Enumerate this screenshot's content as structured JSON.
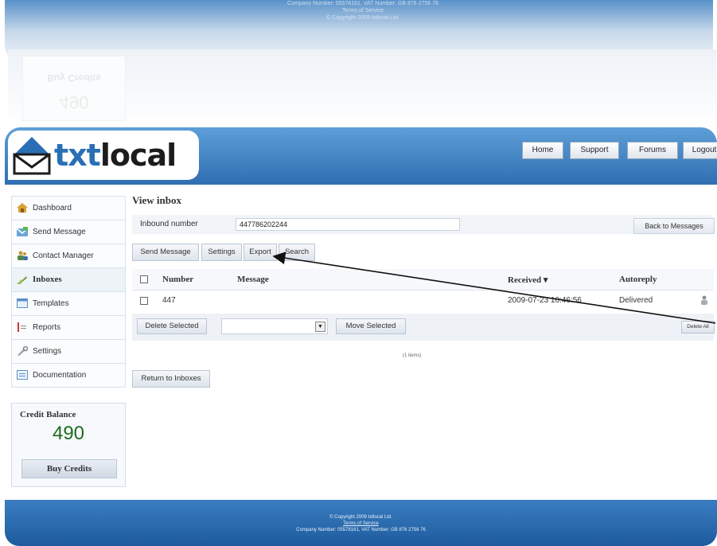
{
  "reflection": {
    "lines": [
      "Company Number: 05578161, VAT Number: GB 876 2756 76",
      "Terms of Service",
      "© Copyright 2009 txtlocal Ltd."
    ],
    "card_title": "Buy Credits",
    "card_value": "490"
  },
  "brand": {
    "logo_text_a": "txt",
    "logo_text_b": "local"
  },
  "nav": {
    "home": "Home",
    "support": "Support",
    "forums": "Forums",
    "logout": "Logout"
  },
  "sidebar": {
    "items": [
      {
        "label": "Dashboard",
        "icon": "house-icon"
      },
      {
        "label": "Send Message",
        "icon": "envelope-icon"
      },
      {
        "label": "Contact Manager",
        "icon": "people-icon"
      },
      {
        "label": "Inboxes",
        "icon": "inbox-icon"
      },
      {
        "label": "Templates",
        "icon": "template-icon"
      },
      {
        "label": "Reports",
        "icon": "report-icon"
      },
      {
        "label": "Settings",
        "icon": "wrench-icon"
      },
      {
        "label": "Documentation",
        "icon": "document-icon"
      }
    ]
  },
  "credit": {
    "title": "Credit Balance",
    "value": "490",
    "buy_label": "Buy Credits"
  },
  "main": {
    "title": "View inbox",
    "inbound_label": "Inbound number",
    "inbound_value": "447786202244",
    "back_label": "Back to Messages",
    "toolbar": {
      "send": "Send Message",
      "settings": "Settings",
      "export": "Export",
      "search": "Search"
    },
    "columns": {
      "number": "Number",
      "message": "Message",
      "received": "Received ▾",
      "autoreply": "Autoreply"
    },
    "rows": [
      {
        "number": "447",
        "message": "",
        "received": "2009-07-23 10:46:56",
        "autoreply": "Delivered"
      }
    ],
    "delete_selected": "Delete Selected",
    "move_selected": "Move Selected",
    "delete_all": "Delete All",
    "items_count": "(1 items)",
    "return_label": "Return to Inboxes"
  },
  "footer": {
    "copyright": "© Copyright 2009 txtlocal Ltd.",
    "terms": "Terms of Service",
    "company": "Company Number: 05578161, VAT Number: GB 876 2756 76"
  }
}
